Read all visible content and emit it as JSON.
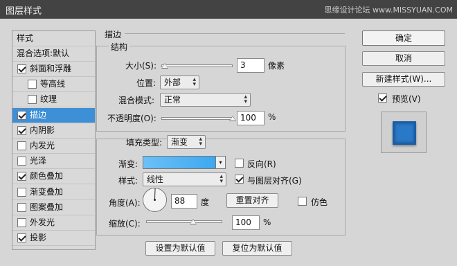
{
  "window": {
    "title": "图层样式",
    "watermark": "思缘设计论坛 www.MISSYUAN.COM"
  },
  "left_panel": {
    "header": "样式",
    "blend_options": "混合选项:默认",
    "items": [
      {
        "label": "斜面和浮雕",
        "checked": true
      },
      {
        "label": "等高线",
        "checked": false
      },
      {
        "label": "纹理",
        "checked": false
      },
      {
        "label": "描边",
        "checked": true
      },
      {
        "label": "内阴影",
        "checked": true
      },
      {
        "label": "内发光",
        "checked": false
      },
      {
        "label": "光泽",
        "checked": false
      },
      {
        "label": "颜色叠加",
        "checked": true
      },
      {
        "label": "渐变叠加",
        "checked": false
      },
      {
        "label": "图案叠加",
        "checked": false
      },
      {
        "label": "外发光",
        "checked": false
      },
      {
        "label": "投影",
        "checked": true
      }
    ]
  },
  "stroke": {
    "title": "描边",
    "structure_title": "结构",
    "size_label": "大小(S):",
    "size_value": "3",
    "size_unit": "像素",
    "size_fraction": 0.0,
    "position_label": "位置:",
    "position_value": "外部",
    "blend_label": "混合模式:",
    "blend_value": "正常",
    "opacity_label": "不透明度(O):",
    "opacity_value": "100",
    "opacity_unit": "%",
    "opacity_fraction": 1.0
  },
  "fill": {
    "fill_type_label": "填充类型:",
    "fill_type_value": "渐变",
    "gradient_label": "渐变:",
    "gradient_colors": [
      "#6cc0f7",
      "#3da8ef"
    ],
    "reverse_label": "反向(R)",
    "reverse_checked": false,
    "style_label": "样式:",
    "style_value": "线性",
    "align_label": "与图层对齐(G)",
    "align_checked": true,
    "angle_label": "角度(A):",
    "angle_value": "88",
    "angle_unit": "度",
    "reset_align": "重置对齐",
    "dither_label": "仿色",
    "dither_checked": false,
    "scale_label": "缩放(C):",
    "scale_value": "100",
    "scale_unit": "%",
    "scale_fraction": 0.62
  },
  "bottom": {
    "set_default": "设置为默认值",
    "reset_default": "复位为默认值"
  },
  "right": {
    "ok": "确定",
    "cancel": "取消",
    "new_style": "新建样式(W)...",
    "preview_label": "预览(V)",
    "preview_checked": true
  },
  "colors": {
    "accent": "#3d8fd6",
    "preview_fill": "#2a78c8",
    "preview_bg": "#d0d0d0"
  }
}
